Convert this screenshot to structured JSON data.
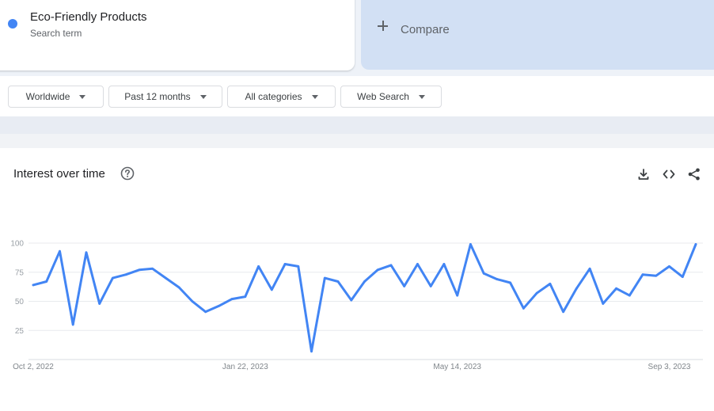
{
  "search_term": {
    "name": "Eco-Friendly Products",
    "type": "Search term",
    "color": "#4285f4"
  },
  "compare": {
    "label": "Compare"
  },
  "filters": [
    {
      "label": "Worldwide"
    },
    {
      "label": "Past 12 months"
    },
    {
      "label": "All categories"
    },
    {
      "label": "Web Search"
    }
  ],
  "interest_over_time": {
    "title": "Interest over time",
    "icons": [
      "help-icon",
      "download-icon",
      "embed-icon",
      "share-icon"
    ]
  },
  "chart_data": {
    "type": "line",
    "title": "Interest over time",
    "xlabel": "",
    "ylabel": "",
    "ylim": [
      0,
      100
    ],
    "yticks": [
      25,
      50,
      75,
      100
    ],
    "x_tick_labels": [
      "Oct 2, 2022",
      "Jan 22, 2023",
      "May 14, 2023",
      "Sep 3, 2023"
    ],
    "x_tick_indices": [
      0,
      16,
      32,
      48
    ],
    "grid": true,
    "series": [
      {
        "color": "#4285f4",
        "values": [
          64,
          67,
          93,
          30,
          92,
          48,
          70,
          73,
          77,
          78,
          70,
          62,
          50,
          41,
          46,
          52,
          54,
          80,
          60,
          82,
          80,
          7,
          70,
          67,
          51,
          67,
          77,
          81,
          63,
          82,
          63,
          82,
          55,
          99,
          74,
          69,
          66,
          44,
          57,
          65,
          41,
          61,
          78,
          48,
          61,
          55,
          73,
          72,
          80,
          71,
          99
        ]
      }
    ]
  }
}
